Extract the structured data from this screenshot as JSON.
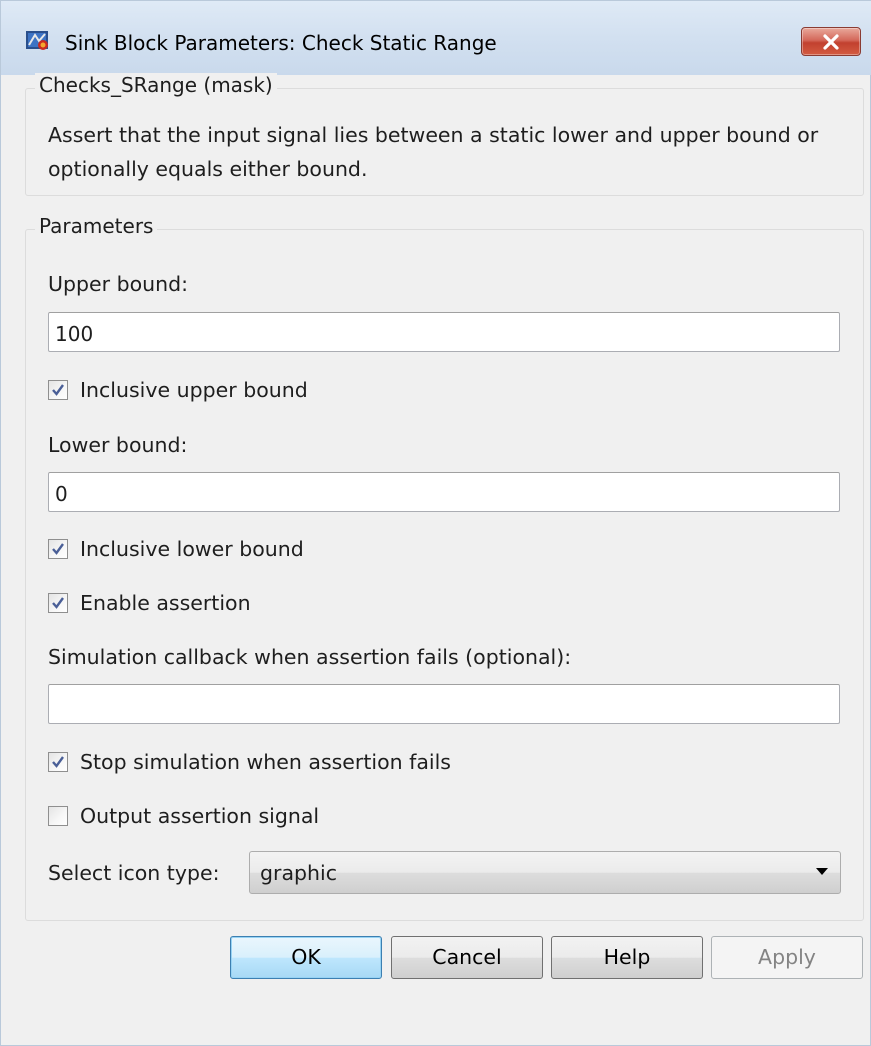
{
  "window": {
    "title": "Sink Block Parameters: Check Static Range"
  },
  "mask_group": {
    "legend": "Checks_SRange (mask)",
    "description": "Assert that the input signal lies between a static lower and upper bound or optionally equals either bound."
  },
  "parameters": {
    "legend": "Parameters",
    "upper_bound_label": "Upper bound:",
    "upper_bound_value": "100",
    "inclusive_upper_label": "Inclusive upper bound",
    "inclusive_upper_checked": true,
    "lower_bound_label": "Lower bound:",
    "lower_bound_value": "0",
    "inclusive_lower_label": "Inclusive lower bound",
    "inclusive_lower_checked": true,
    "enable_assertion_label": "Enable assertion",
    "enable_assertion_checked": true,
    "callback_label": "Simulation callback when assertion fails (optional):",
    "callback_value": "",
    "stop_sim_label": "Stop simulation when assertion fails",
    "stop_sim_checked": true,
    "output_signal_label": "Output assertion signal",
    "output_signal_checked": false,
    "icon_type_label": "Select icon type:",
    "icon_type_value": "graphic"
  },
  "buttons": {
    "ok": "OK",
    "cancel": "Cancel",
    "help": "Help",
    "apply": "Apply"
  },
  "icons": {
    "app": "simulink-block-icon",
    "close": "close-icon",
    "check": "checkmark-icon",
    "dropdown": "dropdown-arrow-icon"
  },
  "colors": {
    "titlebar": "#d2e0f0",
    "close_button": "#c2412f",
    "dialog_bg": "#f0f0f0",
    "default_button": "#bee6fd",
    "disabled_text": "#838383"
  }
}
